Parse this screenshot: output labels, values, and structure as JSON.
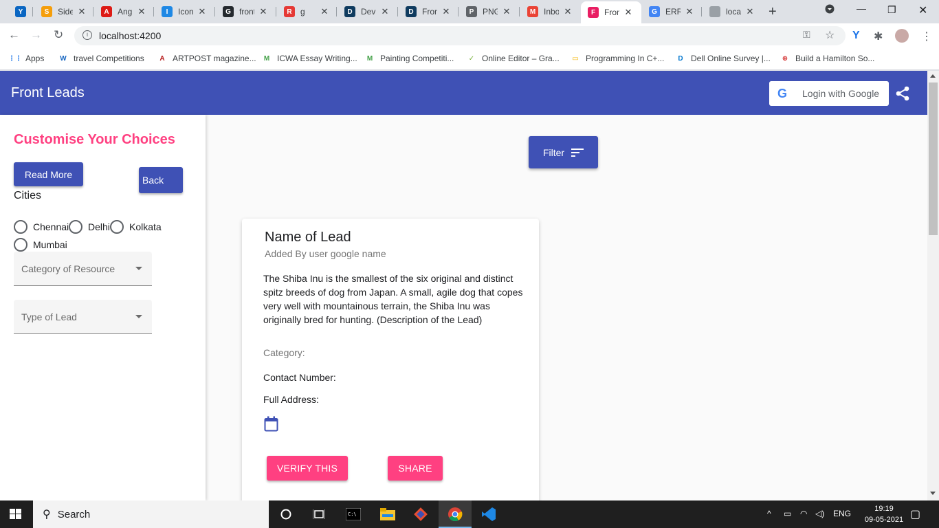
{
  "browser": {
    "tabs": [
      {
        "label": "",
        "icon": "Y",
        "color": "#0a66c2"
      },
      {
        "label": "Side",
        "icon": "S",
        "color": "#f59e0b"
      },
      {
        "label": "Angu",
        "icon": "A",
        "color": "#dd1b16"
      },
      {
        "label": "Icon",
        "icon": "I",
        "color": "#1e88e5"
      },
      {
        "label": "front",
        "icon": "G",
        "color": "#24292e"
      },
      {
        "label": "g",
        "icon": "R",
        "color": "#e53935"
      },
      {
        "label": "Dev",
        "icon": "D",
        "color": "#0f3b5f"
      },
      {
        "label": "Fron",
        "icon": "D",
        "color": "#0f3b5f"
      },
      {
        "label": "PNG",
        "icon": "P",
        "color": "#5f6368"
      },
      {
        "label": "Inbo",
        "icon": "M",
        "color": "#ea4335"
      },
      {
        "label": "Fron",
        "icon": "F",
        "color": "#e91e63"
      },
      {
        "label": "ERR",
        "icon": "G",
        "color": "#4285f4"
      },
      {
        "label": "local",
        "icon": "",
        "color": "#9aa0a6"
      }
    ],
    "url": "localhost:4200",
    "bookmarks": [
      {
        "label": "Apps",
        "icon": "⋮⋮",
        "color": "#1a73e8"
      },
      {
        "label": "travel Competitions",
        "icon": "W",
        "color": "#1565c0"
      },
      {
        "label": "ARTPOST magazine...",
        "icon": "A",
        "color": "#b71c1c"
      },
      {
        "label": "ICWA Essay Writing...",
        "icon": "M",
        "color": "#43a047"
      },
      {
        "label": "Painting Competiti...",
        "icon": "M",
        "color": "#43a047"
      },
      {
        "label": "Online Editor – Gra...",
        "icon": "✓",
        "color": "#7cb342"
      },
      {
        "label": "Programming In C+...",
        "icon": "▭",
        "color": "#f4b400"
      },
      {
        "label": "Dell Online Survey |...",
        "icon": "D",
        "color": "#0076ce"
      },
      {
        "label": "Build a Hamilton So...",
        "icon": "⊕",
        "color": "#d32f2f"
      }
    ]
  },
  "app": {
    "title": "Front Leads",
    "login_label": "Login with Google",
    "login_g": "G"
  },
  "sidebar": {
    "title": "Customise Your Choices",
    "read_more": "Read More",
    "back": "Back",
    "cities_label": "Cities",
    "cities": [
      "Chennai",
      "Delhi",
      "Kolkata",
      "Mumbai"
    ],
    "category_placeholder": "Category of Resource",
    "type_placeholder": "Type of Lead"
  },
  "filter": {
    "label": "Filter"
  },
  "card": {
    "title": "Name of Lead",
    "subtitle": "Added By user google name",
    "description": "The Shiba Inu is the smallest of the six original and distinct spitz breeds of dog from Japan. A small, agile dog that copes very well with mountainous terrain, the Shiba Inu was originally bred for hunting. (Description of the Lead)",
    "category_label": "Category:",
    "contact_label": "Contact Number:",
    "address_label": "Full Address:",
    "verify_label": "VERIFY THIS",
    "share_label": "SHARE"
  },
  "taskbar": {
    "search_label": "Search",
    "language": "ENG",
    "time": "19:19",
    "date": "09-05-2021"
  },
  "colors": {
    "primary": "#3f51b5",
    "accent": "#ff4081"
  }
}
